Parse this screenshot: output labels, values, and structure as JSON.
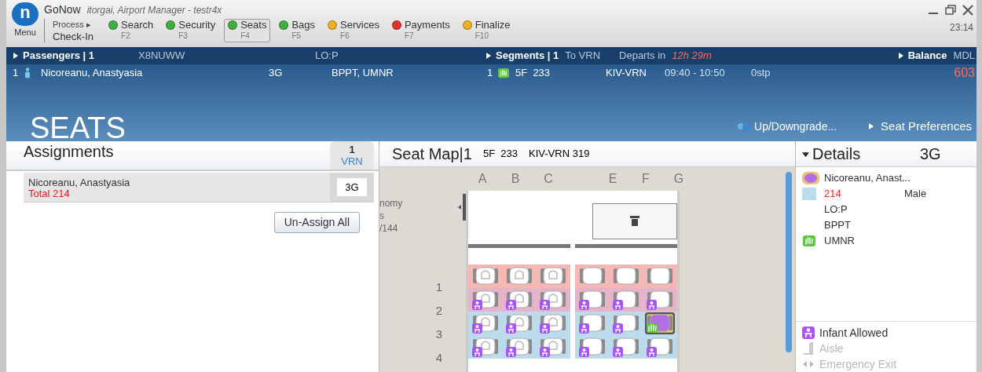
{
  "app": {
    "logo": "n",
    "name": "GoNow",
    "user": "itorgai, Airport Manager - testr4x",
    "menu": "Menu",
    "process": "Process ▸",
    "process_value": "Check-In",
    "clock": "23:14"
  },
  "steps": [
    {
      "label": "Search",
      "key": "F2",
      "color": "#3fb03f",
      "selected": false
    },
    {
      "label": "Security",
      "key": "F3",
      "color": "#3fb03f",
      "selected": false
    },
    {
      "label": "Seats",
      "key": "F4",
      "color": "#3fb03f",
      "selected": true
    },
    {
      "label": "Bags",
      "key": "F5",
      "color": "#3fb03f",
      "selected": false
    },
    {
      "label": "Services",
      "key": "F6",
      "color": "#f0b020",
      "selected": false
    },
    {
      "label": "Payments",
      "key": "F7",
      "color": "#e03030",
      "selected": false
    },
    {
      "label": "Finalize",
      "key": "F10",
      "color": "#f0b020",
      "selected": false
    }
  ],
  "passengers": {
    "title": "Passengers | 1",
    "pnr": "X8NUWW",
    "lo": "LO:P",
    "row": {
      "index": "1",
      "name": "Nicoreanu, Anastyasia",
      "seat": "3G",
      "ssr": "BPPT, UMNR"
    }
  },
  "segments": {
    "title": "Segments | 1",
    "to": "To VRN",
    "departs_label": "Departs in",
    "departs_value": "12h 29m",
    "row": {
      "index": "1",
      "flight": "5F  233",
      "route": "KIV-VRN",
      "time": "09:40 - 10:50",
      "stops": "0stp"
    }
  },
  "balance": {
    "title": "Balance",
    "currency": "MDL",
    "amount": "603"
  },
  "page_title": "SEATS",
  "upgrade": "Up/Downgrade...",
  "seat_preferences": "Seat Preferences",
  "assignments": {
    "title": "Assignments",
    "segment_number": "1",
    "segment_code": "VRN",
    "rows": [
      {
        "name": "Nicoreanu, Anastyasia",
        "total": "Total 214",
        "seat": "3G"
      }
    ],
    "unassign": "Un-Assign All"
  },
  "seat_map": {
    "title": "Seat Map|1",
    "flight": "5F  233",
    "route": "KIV-VRN",
    "aircraft": "319",
    "side_labels": [
      "nomy",
      "s",
      "/144"
    ],
    "left_columns": [
      "A",
      "B",
      "C"
    ],
    "right_columns": [
      "E",
      "F",
      "G"
    ],
    "rows": [
      {
        "number": "1",
        "color": "#f6b8b4",
        "seats": [
          {
            "locked": true,
            "infant": false,
            "selected": false
          },
          {
            "locked": true,
            "infant": false,
            "selected": false
          },
          {
            "locked": true,
            "infant": false,
            "selected": false
          },
          {
            "locked": false,
            "infant": false,
            "selected": false
          },
          {
            "locked": false,
            "infant": false,
            "selected": false
          },
          {
            "locked": false,
            "infant": false,
            "selected": false
          }
        ]
      },
      {
        "number": "2",
        "color": "#e6b4c8",
        "seats": [
          {
            "locked": true,
            "infant": true,
            "selected": false
          },
          {
            "locked": true,
            "infant": true,
            "selected": false
          },
          {
            "locked": true,
            "infant": true,
            "selected": false
          },
          {
            "locked": false,
            "infant": true,
            "selected": false
          },
          {
            "locked": false,
            "infant": true,
            "selected": false
          },
          {
            "locked": false,
            "infant": true,
            "selected": false
          }
        ]
      },
      {
        "number": "3",
        "color": "#bcdcee",
        "seats": [
          {
            "locked": true,
            "infant": true,
            "selected": false
          },
          {
            "locked": true,
            "infant": true,
            "selected": false
          },
          {
            "locked": true,
            "infant": true,
            "selected": false
          },
          {
            "locked": false,
            "infant": true,
            "selected": false
          },
          {
            "locked": false,
            "infant": true,
            "selected": false
          },
          {
            "locked": false,
            "infant": false,
            "selected": true
          }
        ]
      },
      {
        "number": "4",
        "color": "#bcdcee",
        "seats": [
          {
            "locked": true,
            "infant": true,
            "selected": false
          },
          {
            "locked": true,
            "infant": true,
            "selected": false
          },
          {
            "locked": true,
            "infant": true,
            "selected": false
          },
          {
            "locked": false,
            "infant": true,
            "selected": false
          },
          {
            "locked": false,
            "infant": true,
            "selected": false
          },
          {
            "locked": false,
            "infant": true,
            "selected": false
          }
        ]
      }
    ]
  },
  "details": {
    "title": "Details",
    "seat": "3G",
    "name": "Nicoreanu, Anast...",
    "total": "214",
    "gender": "Male",
    "lo": "LO:P",
    "ssr": "BPPT",
    "umnr": "UMNR",
    "legend": [
      {
        "kind": "infant",
        "label": "Infant Allowed",
        "disabled": false
      },
      {
        "kind": "aisle",
        "label": "Aisle",
        "disabled": true
      },
      {
        "kind": "exit",
        "label": "Emergency Exit",
        "disabled": true
      }
    ]
  }
}
